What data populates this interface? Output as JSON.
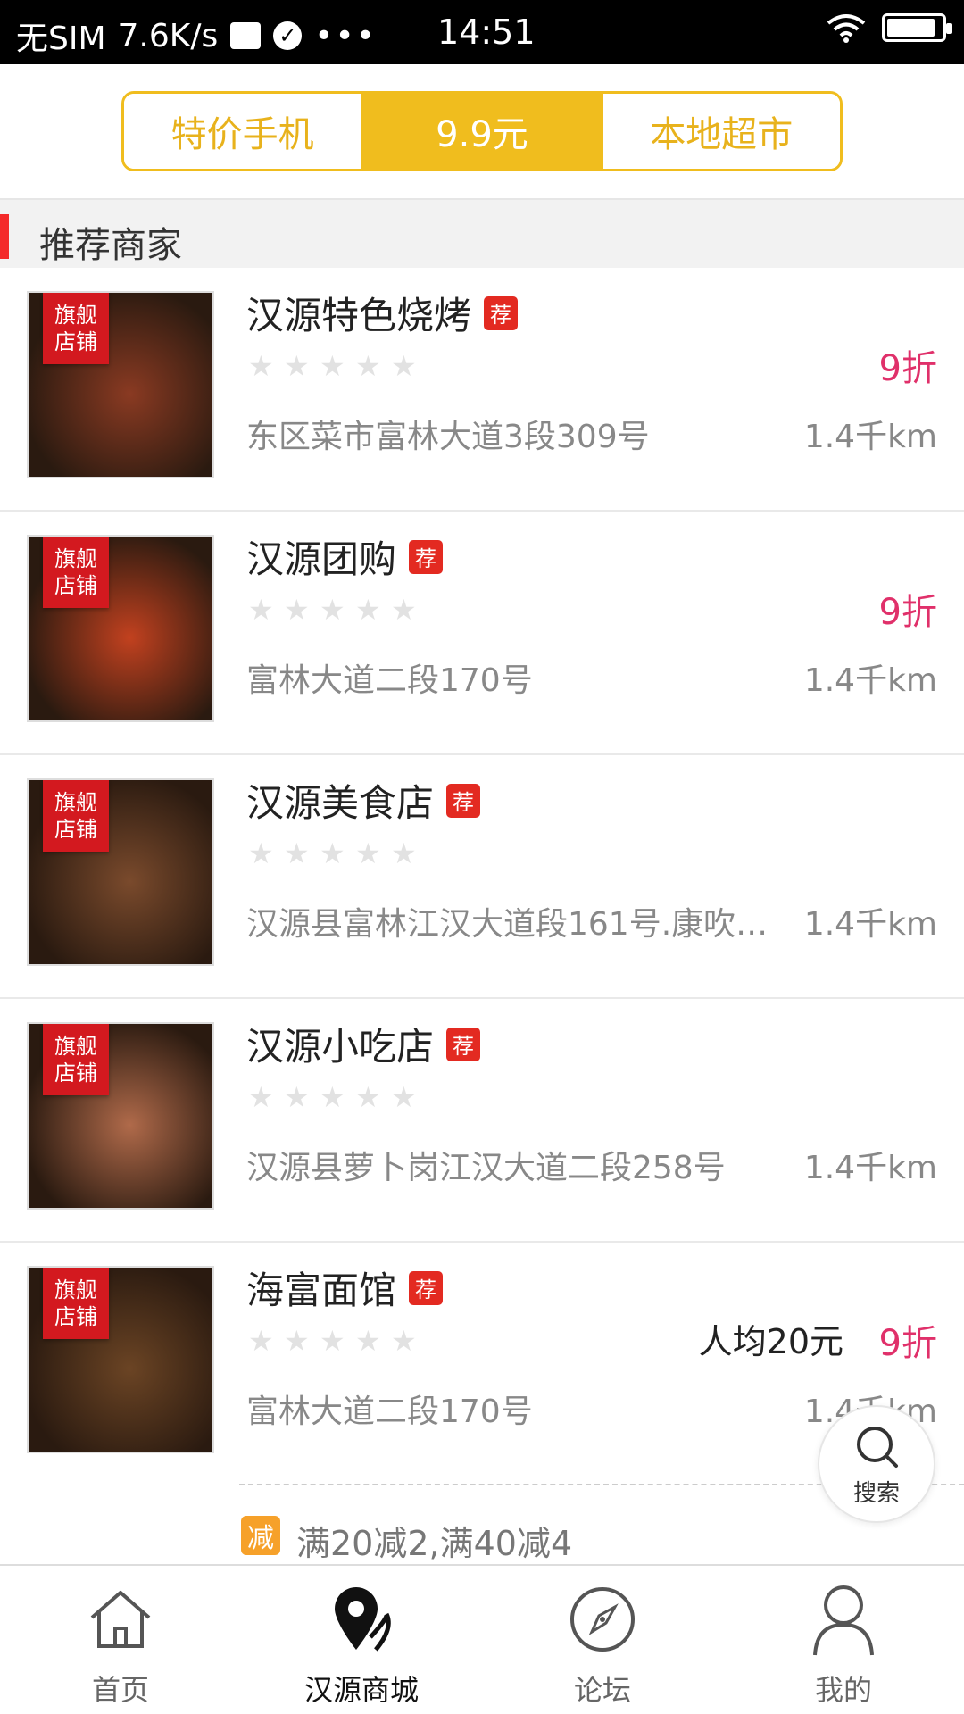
{
  "status_bar": {
    "carrier": "无SIM",
    "speed": "7.6K/s",
    "time": "14:51",
    "battery_level": 0.9
  },
  "segments": [
    {
      "label": "特价手机",
      "active": false
    },
    {
      "label": "9.9元",
      "active": true
    },
    {
      "label": "本地超市",
      "active": false
    }
  ],
  "section": {
    "title": "推荐商家"
  },
  "merchant_flag": "旗舰店铺",
  "merchant_flag_line1": "旗舰",
  "merchant_flag_line2": "店铺",
  "rec_tag": "荐",
  "merchants": [
    {
      "name": "汉源特色烧烤",
      "rating": 0,
      "discount": "9折",
      "avg_price": "",
      "address": "东区菜市富林大道3段309号",
      "distance": "1.4千km",
      "thumb_color": "#8a3a22"
    },
    {
      "name": "汉源团购",
      "rating": 0,
      "discount": "9折",
      "avg_price": "",
      "address": "富林大道二段170号",
      "distance": "1.4千km",
      "thumb_color": "#c2411f"
    },
    {
      "name": "汉源美食店",
      "rating": 0,
      "discount": "",
      "avg_price": "",
      "address": "汉源县富林江汉大道段161号.康吹…",
      "distance": "1.4千km",
      "thumb_color": "#7a4a2c"
    },
    {
      "name": "汉源小吃店",
      "rating": 0,
      "discount": "",
      "avg_price": "",
      "address": "汉源县萝卜岗江汉大道二段258号",
      "distance": "1.4千km",
      "thumb_color": "#b06a4a"
    },
    {
      "name": "海富面馆",
      "rating": 0,
      "discount": "9折",
      "avg_price": "人均20元",
      "address": "富林大道二段170号",
      "distance": "1.4千km",
      "thumb_color": "#6b4424"
    }
  ],
  "promo": {
    "tag": "减",
    "text": "满20减2,满40减4"
  },
  "fab": {
    "label": "搜索"
  },
  "tabbar": [
    {
      "label": "首页",
      "icon": "home-icon",
      "active": false
    },
    {
      "label": "汉源商城",
      "icon": "map-pin-icon",
      "active": true
    },
    {
      "label": "论坛",
      "icon": "compass-icon",
      "active": false
    },
    {
      "label": "我的",
      "icon": "user-icon",
      "active": false
    }
  ],
  "colors": {
    "accent": "#f0bd1e",
    "discount": "#e0306a",
    "section_bar": "#f42a2a"
  }
}
